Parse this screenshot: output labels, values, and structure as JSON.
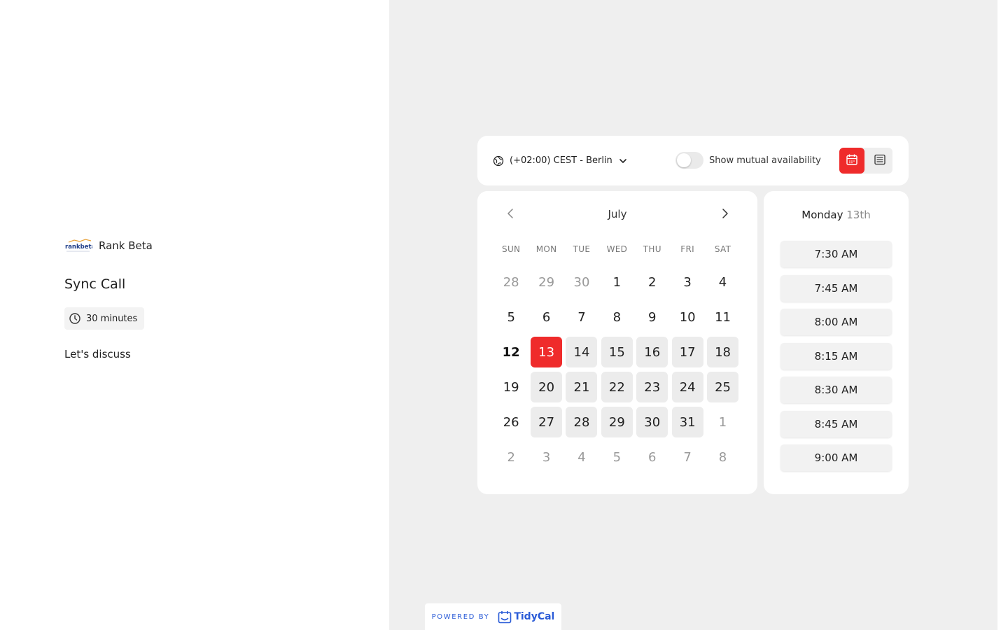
{
  "brand": {
    "logo_text": "rankbeta",
    "name": "Rank Beta"
  },
  "event": {
    "title": "Sync Call",
    "duration": "30 minutes",
    "description": "Let's discuss"
  },
  "timezone": {
    "label": "(+02:00) CEST - Berlin"
  },
  "mutual": {
    "label": "Show mutual availability",
    "enabled": false
  },
  "view": {
    "active": "calendar",
    "icons": [
      "calendar-icon",
      "list-icon"
    ]
  },
  "calendar": {
    "month": "July",
    "weekdays": [
      "SUN",
      "MON",
      "TUE",
      "WED",
      "THU",
      "FRI",
      "SAT"
    ],
    "days": [
      {
        "d": "28",
        "s": "out"
      },
      {
        "d": "29",
        "s": "out"
      },
      {
        "d": "30",
        "s": "out"
      },
      {
        "d": "1",
        "s": "plain"
      },
      {
        "d": "2",
        "s": "plain"
      },
      {
        "d": "3",
        "s": "plain"
      },
      {
        "d": "4",
        "s": "plain"
      },
      {
        "d": "5",
        "s": "plain"
      },
      {
        "d": "6",
        "s": "plain"
      },
      {
        "d": "7",
        "s": "plain"
      },
      {
        "d": "8",
        "s": "plain"
      },
      {
        "d": "9",
        "s": "plain"
      },
      {
        "d": "10",
        "s": "plain"
      },
      {
        "d": "11",
        "s": "plain"
      },
      {
        "d": "12",
        "s": "today"
      },
      {
        "d": "13",
        "s": "selected"
      },
      {
        "d": "14",
        "s": "avail"
      },
      {
        "d": "15",
        "s": "avail"
      },
      {
        "d": "16",
        "s": "avail"
      },
      {
        "d": "17",
        "s": "avail"
      },
      {
        "d": "18",
        "s": "avail"
      },
      {
        "d": "19",
        "s": "plain"
      },
      {
        "d": "20",
        "s": "avail"
      },
      {
        "d": "21",
        "s": "avail"
      },
      {
        "d": "22",
        "s": "avail"
      },
      {
        "d": "23",
        "s": "avail"
      },
      {
        "d": "24",
        "s": "avail"
      },
      {
        "d": "25",
        "s": "avail"
      },
      {
        "d": "26",
        "s": "plain"
      },
      {
        "d": "27",
        "s": "avail"
      },
      {
        "d": "28",
        "s": "avail"
      },
      {
        "d": "29",
        "s": "avail"
      },
      {
        "d": "30",
        "s": "avail"
      },
      {
        "d": "31",
        "s": "avail"
      },
      {
        "d": "1",
        "s": "out"
      },
      {
        "d": "2",
        "s": "out"
      },
      {
        "d": "3",
        "s": "out"
      },
      {
        "d": "4",
        "s": "out"
      },
      {
        "d": "5",
        "s": "out"
      },
      {
        "d": "6",
        "s": "out"
      },
      {
        "d": "7",
        "s": "out"
      },
      {
        "d": "8",
        "s": "out"
      }
    ]
  },
  "slots": {
    "weekday": "Monday",
    "daynum": "13th",
    "times": [
      "7:30 AM",
      "7:45 AM",
      "8:00 AM",
      "8:15 AM",
      "8:30 AM",
      "8:45 AM",
      "9:00 AM"
    ]
  },
  "footer": {
    "powered_by": "POWERED BY",
    "brand": "TidyCal"
  },
  "colors": {
    "accent": "#ef2b2b",
    "available_bg": "#ececec",
    "page_bg": "#efefef",
    "tidycal_blue": "#2a5bd7"
  }
}
